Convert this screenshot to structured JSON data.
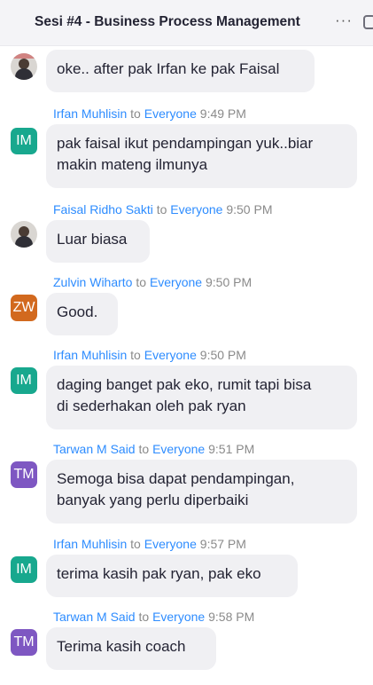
{
  "header": {
    "title": "Sesi #4 - Business Process Management",
    "more_label": "···"
  },
  "messages": [
    {
      "text": "oke.. after pak Irfan ke pak Faisal"
    },
    {
      "sender": "Irfan Muhlisin",
      "to_word": "to",
      "recipient": "Everyone",
      "time": "9:49 PM",
      "initials": "IM",
      "lines": [
        "pak faisal ikut pendampingan yuk..biar",
        "makin mateng ilmunya"
      ]
    },
    {
      "sender": "Faisal Ridho Sakti",
      "to_word": "to",
      "recipient": "Everyone",
      "time": "9:50 PM",
      "text": "Luar biasa"
    },
    {
      "sender": "Zulvin Wiharto",
      "to_word": "to",
      "recipient": "Everyone",
      "time": "9:50 PM",
      "initials": "ZW",
      "text": "Good."
    },
    {
      "sender": "Irfan Muhlisin",
      "to_word": "to",
      "recipient": "Everyone",
      "time": "9:50 PM",
      "initials": "IM",
      "lines": [
        "daging banget pak eko, rumit tapi bisa",
        "di sederhakan oleh pak ryan"
      ]
    },
    {
      "sender": "Tarwan M Said",
      "to_word": "to",
      "recipient": "Everyone",
      "time": "9:51 PM",
      "initials": "TM",
      "lines": [
        "Semoga bisa dapat pendampingan,",
        "banyak yang perlu diperbaiki"
      ]
    },
    {
      "sender": "Irfan Muhlisin",
      "to_word": "to",
      "recipient": "Everyone",
      "time": "9:57 PM",
      "initials": "IM",
      "text": "terima kasih pak ryan, pak eko"
    },
    {
      "sender": "Tarwan M Said",
      "to_word": "to",
      "recipient": "Everyone",
      "time": "9:58 PM",
      "initials": "TM",
      "text": "Terima kasih coach"
    }
  ],
  "colors": {
    "name_link": "#2d8cff",
    "bubble_bg": "#f0f0f3",
    "avatar_im": "#18a88e",
    "avatar_zw": "#d2691e",
    "avatar_tm": "#7e57c2"
  }
}
